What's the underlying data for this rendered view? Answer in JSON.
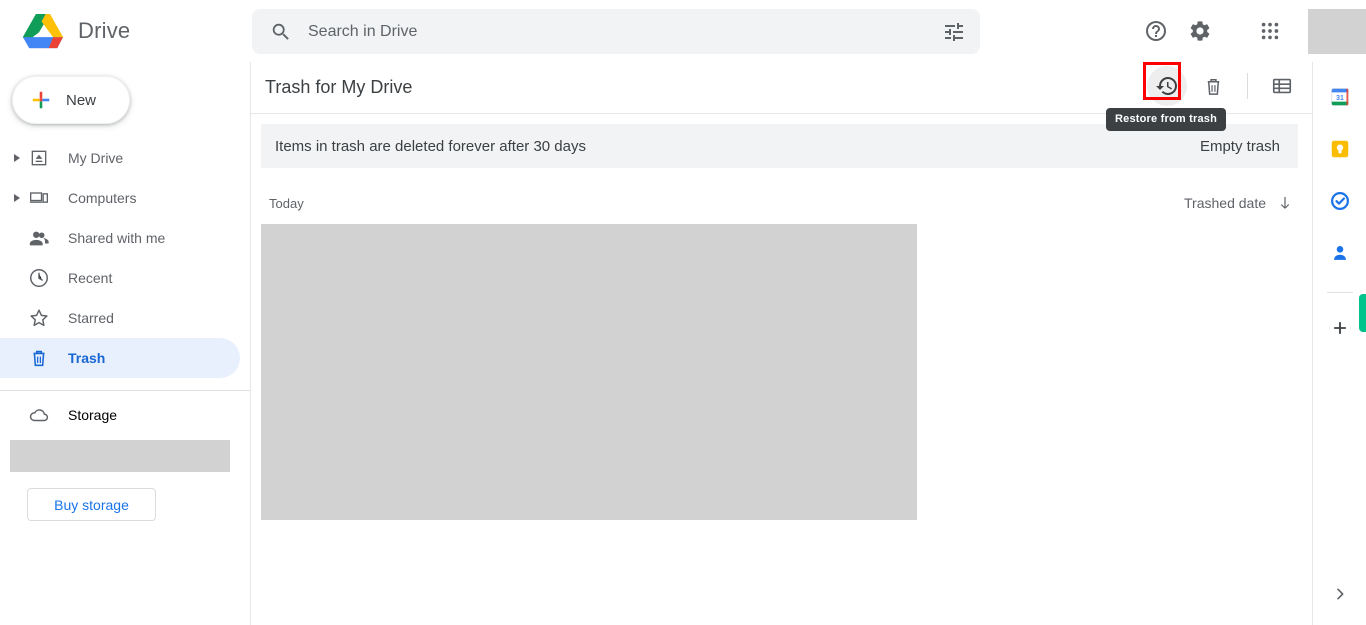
{
  "app": {
    "brand_title": "Drive",
    "logo_icon": "google-drive-logo"
  },
  "search": {
    "placeholder": "Search in Drive",
    "value": "",
    "search_icon": "search-icon",
    "filter_icon": "tune-filter-icon"
  },
  "topbar": {
    "help_icon": "help-circle-icon",
    "settings_icon": "gear-icon",
    "apps_icon": "apps-grid-icon",
    "avatar": "account-avatar"
  },
  "sidebar": {
    "new_button": "New",
    "new_icon": "plus-multicolor-icon",
    "items": [
      {
        "label": "My Drive",
        "icon": "my-drive-icon",
        "expandable": true,
        "active": false
      },
      {
        "label": "Computers",
        "icon": "computers-icon",
        "expandable": true,
        "active": false
      },
      {
        "label": "Shared with me",
        "icon": "shared-with-me-icon",
        "expandable": false,
        "active": false
      },
      {
        "label": "Recent",
        "icon": "clock-icon",
        "expandable": false,
        "active": false
      },
      {
        "label": "Starred",
        "icon": "star-icon",
        "expandable": false,
        "active": false
      },
      {
        "label": "Trash",
        "icon": "trash-icon",
        "expandable": false,
        "active": true
      }
    ],
    "storage_label": "Storage",
    "storage_icon": "cloud-icon",
    "buy_storage": "Buy storage"
  },
  "main": {
    "title": "Trash for My Drive",
    "actions": {
      "restore_icon": "restore-from-trash-icon",
      "delete_icon": "delete-forever-icon",
      "list_view_icon": "list-view-icon"
    },
    "tooltip": "Restore from trash",
    "banner": {
      "message": "Items in trash are deleted forever after 30 days",
      "empty_trash": "Empty trash"
    },
    "list": {
      "group_title": "Today",
      "sort_label": "Trashed date",
      "sort_icon": "arrow-down-icon"
    }
  },
  "rail": {
    "items": [
      {
        "icon": "google-calendar-icon"
      },
      {
        "icon": "google-keep-icon"
      },
      {
        "icon": "google-tasks-icon"
      },
      {
        "icon": "google-contacts-icon"
      }
    ],
    "add_icon": "plus-icon",
    "expand_icon": "chevron-right-icon"
  },
  "colors": {
    "accent_blue": "#1a73e8",
    "active_pill": "#e8f0fe",
    "active_text": "#1967d2",
    "highlight_red": "#ff0000",
    "tooltip_bg": "#3c4043",
    "banner_bg": "#f1f3f4",
    "redaction_gray": "#d2d2d2"
  }
}
